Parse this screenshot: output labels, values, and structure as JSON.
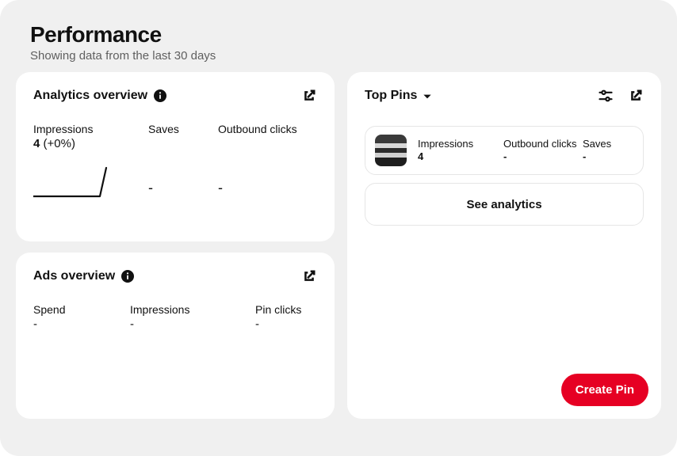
{
  "header": {
    "title": "Performance",
    "subtitle": "Showing data from the last 30 days"
  },
  "analytics": {
    "title": "Analytics overview",
    "metrics": {
      "impressions": {
        "label": "Impressions",
        "value": "4",
        "delta": "(+0%)"
      },
      "saves": {
        "label": "Saves",
        "value": "-"
      },
      "outbound": {
        "label": "Outbound clicks",
        "value": "-"
      }
    }
  },
  "ads": {
    "title": "Ads overview",
    "metrics": {
      "spend": {
        "label": "Spend",
        "value": "-"
      },
      "impressions": {
        "label": "Impressions",
        "value": "-"
      },
      "pinclicks": {
        "label": "Pin clicks",
        "value": "-"
      }
    }
  },
  "top": {
    "title": "Top Pins",
    "pin": {
      "impressions": {
        "label": "Impressions",
        "value": "4"
      },
      "outbound": {
        "label": "Outbound clicks",
        "value": "-"
      },
      "saves": {
        "label": "Saves",
        "value": "-"
      }
    },
    "see_analytics": "See analytics",
    "create_pin": "Create Pin"
  },
  "chart_data": {
    "type": "line",
    "series": [
      {
        "name": "Impressions",
        "values": [
          0,
          0,
          0,
          0,
          0,
          0,
          0,
          0,
          0,
          4
        ]
      }
    ],
    "x": [
      1,
      2,
      3,
      4,
      5,
      6,
      7,
      8,
      9,
      10
    ],
    "ylim": [
      0,
      4
    ],
    "title": "",
    "xlabel": "",
    "ylabel": ""
  }
}
